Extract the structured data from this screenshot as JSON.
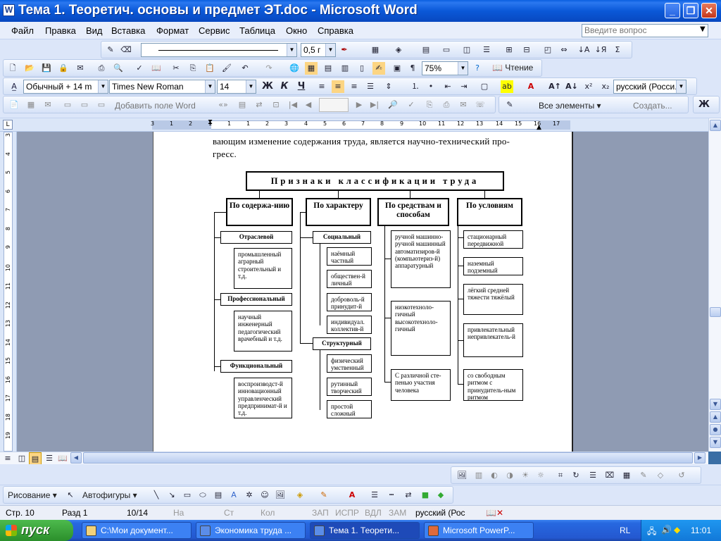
{
  "window": {
    "title": "Тема 1. Теоретич. основы и предмет ЭТ.doc - Microsoft Word"
  },
  "menu": {
    "items": [
      "Файл",
      "Правка",
      "Вид",
      "Вставка",
      "Формат",
      "Сервис",
      "Таблица",
      "Окно",
      "Справка"
    ],
    "ask_placeholder": "Введите вопрос"
  },
  "tables_toolbar": {
    "line_weight": "0,5 г"
  },
  "standard_toolbar": {
    "zoom": "75%",
    "read_label": "Чтение"
  },
  "format_toolbar": {
    "style": "Обычный + 14 m",
    "font": "Times New Roman",
    "size": "14",
    "bold": "Ж",
    "italic": "К",
    "underline": "Ч",
    "language": "русский (Росси."
  },
  "mailmerge_toolbar": {
    "add_field": "Добавить поле Word",
    "all_items": "Все элементы",
    "create": "Создать..."
  },
  "ruler": {
    "marks": [
      "3",
      "1",
      "2",
      "1",
      "1",
      "1",
      "2",
      "3",
      "4",
      "5",
      "6",
      "7",
      "8",
      "9",
      "10",
      "11",
      "12",
      "13",
      "14",
      "15",
      "16",
      "17"
    ]
  },
  "document": {
    "line1": "вающим изменение содержания труда, является научно-технический про-",
    "line2": "гресс.",
    "diagram": {
      "title": "Признаки классификации труда",
      "col1": {
        "header": "По содержа-нию",
        "sub": [
          "Отраслевой",
          "Профессиональный",
          "Функциональный"
        ],
        "items": [
          "промышленный аграрный строительный и т.д.",
          "научный инженерный педагогический врачебный и т.д.",
          "воспроизводст-й инновационный управленческий предпринимат-й и т.д."
        ]
      },
      "col2": {
        "header": "По характеру",
        "sub": [
          "Социальный",
          "Структурный"
        ],
        "items": [
          "наёмный частный",
          "обществен-й личный",
          "доброволь-й принудит-й",
          "индивидуал. коллектив-й",
          "физический умственный",
          "рутинный творческий",
          "простой сложный"
        ]
      },
      "col3": {
        "header": "По средствам и способам",
        "items": [
          "ручной машинно-ручной машинный автоматизиров-й (компьютериз-й) аппаратурный",
          "низкотехноло-гичный высокотехноло-гичный",
          "С различной сте-пенью участия человека"
        ]
      },
      "col4": {
        "header": "По условиям",
        "items": [
          "стационарный передвижной",
          "наземный подземный",
          "лёгкий средней тяжести тяжёлый",
          "привлекательный непривлекатель-й",
          "со свободным ритмом с принудитель-ным ритмом"
        ]
      }
    }
  },
  "drawing_toolbar": {
    "draw": "Рисование",
    "autoshapes": "Автофигуры"
  },
  "status": {
    "page": "Стр. 10",
    "section": "Разд 1",
    "pages": "10/14",
    "at": "На",
    "ln": "Ст",
    "col": "Кол",
    "rec": "ЗАП",
    "trk": "ИСПР",
    "ext": "ВДЛ",
    "ovr": "ЗАМ",
    "lang": "русский (Рос"
  },
  "taskbar": {
    "start": "пуск",
    "tasks": [
      "C:\\Мои документ...",
      "Экономика труда ...",
      "Тема 1. Теорети...",
      "Microsoft PowerP..."
    ],
    "lang": "RL",
    "clock": "11:01"
  }
}
